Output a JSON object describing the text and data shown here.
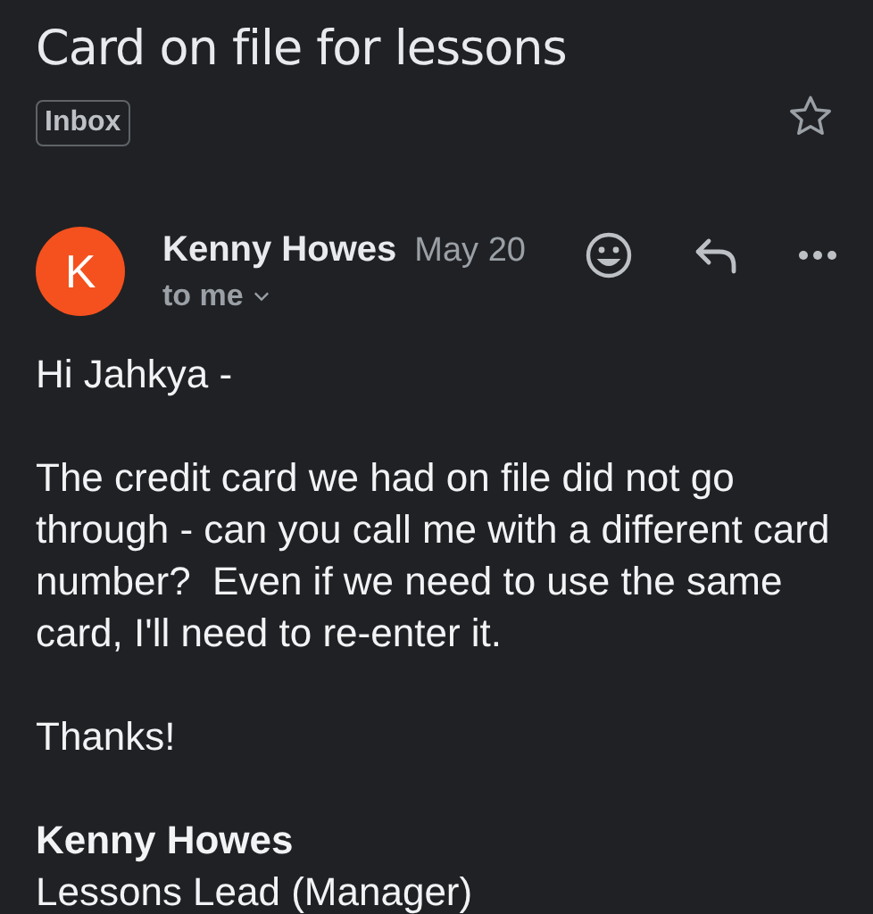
{
  "subject": "Card on file for lessons",
  "label": "Inbox",
  "starred": false,
  "message": {
    "avatar_letter": "K",
    "sender": "Kenny Howes",
    "date": "May 20",
    "recipient": "to me"
  },
  "body": [
    "Hi Jahkya -",
    "The credit card we had on file did not go through - can you call me with a different card number?  Even if we need to use the same card, I'll need to re-enter it.",
    "Thanks!"
  ],
  "signature": {
    "name": "Kenny Howes",
    "role": "Lessons Lead (Manager)"
  }
}
